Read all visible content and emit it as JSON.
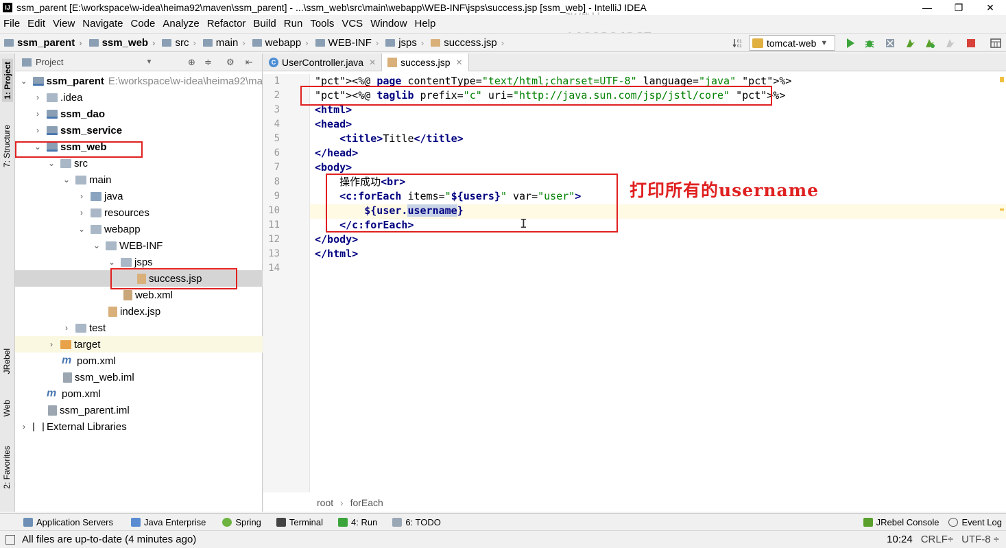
{
  "window": {
    "title": "ssm_parent [E:\\workspace\\w-idea\\heima92\\maven\\ssm_parent] - ...\\ssm_web\\src\\main\\webapp\\WEB-INF\\jsps\\success.jsp [ssm_web] - IntelliJ IDEA",
    "app_icon": "IJ",
    "minimize": "—",
    "maximize": "❐",
    "close": "✕"
  },
  "watermark": {
    "name": "张继林",
    "id": "A190204267"
  },
  "menu": [
    "File",
    "Edit",
    "View",
    "Navigate",
    "Code",
    "Analyze",
    "Refactor",
    "Build",
    "Run",
    "Tools",
    "VCS",
    "Window",
    "Help"
  ],
  "breadcrumbs": [
    "ssm_parent",
    "ssm_web",
    "src",
    "main",
    "webapp",
    "WEB-INF",
    "jsps",
    "success.jsp"
  ],
  "run_config": "tomcat-web",
  "left_stripe": {
    "project": "1: Project",
    "structure": "7: Structure",
    "jrebel": "JRebel",
    "web": "Web",
    "favorites": "2: Favorites"
  },
  "project_panel": {
    "title": "Project",
    "tree": [
      {
        "label": "ssm_parent",
        "extra": "E:\\workspace\\w-idea\\heima92\\ma"
      },
      {
        "label": ".idea"
      },
      {
        "label": "ssm_dao"
      },
      {
        "label": "ssm_service"
      },
      {
        "label": "ssm_web"
      },
      {
        "label": "src"
      },
      {
        "label": "main"
      },
      {
        "label": "java"
      },
      {
        "label": "resources"
      },
      {
        "label": "webapp"
      },
      {
        "label": "WEB-INF"
      },
      {
        "label": "jsps"
      },
      {
        "label": "success.jsp"
      },
      {
        "label": "web.xml"
      },
      {
        "label": "index.jsp"
      },
      {
        "label": "test"
      },
      {
        "label": "target"
      },
      {
        "label": "pom.xml"
      },
      {
        "label": "ssm_web.iml"
      },
      {
        "label": "pom.xml"
      },
      {
        "label": "ssm_parent.iml"
      },
      {
        "label": "External Libraries"
      }
    ]
  },
  "editor": {
    "tabs": [
      {
        "label": "UserController.java",
        "active": false
      },
      {
        "label": "success.jsp",
        "active": true
      }
    ],
    "line_numbers": [
      "1",
      "2",
      "3",
      "4",
      "5",
      "6",
      "7",
      "8",
      "9",
      "10",
      "11",
      "12",
      "13",
      "14"
    ],
    "lines": [
      "<%@ page contentType=\"text/html;charset=UTF-8\" language=\"java\" %>",
      "<%@ taglib prefix=\"c\" uri=\"http://java.sun.com/jsp/jstl/core\" %>",
      "<html>",
      "<head>",
      "    <title>Title</title>",
      "</head>",
      "<body>",
      "    操作成功<br>",
      "    <c:forEach items=\"${users}\" var=\"user\">",
      "        ${user.username}",
      "    </c:forEach>",
      "</body>",
      "</html>",
      ""
    ],
    "breadcrumb": [
      "root",
      "forEach"
    ],
    "annotation": "打印所有的username"
  },
  "tool_windows": {
    "left": [
      "Application Servers",
      "Java Enterprise",
      "Spring",
      "Terminal",
      "4: Run",
      "6: TODO"
    ],
    "right": [
      "JRebel Console",
      "Event Log"
    ]
  },
  "status": {
    "message": "All files are up-to-date (4 minutes ago)",
    "position": "10:24",
    "line_sep": "CRLF÷",
    "encoding": "UTF-8 ÷"
  }
}
